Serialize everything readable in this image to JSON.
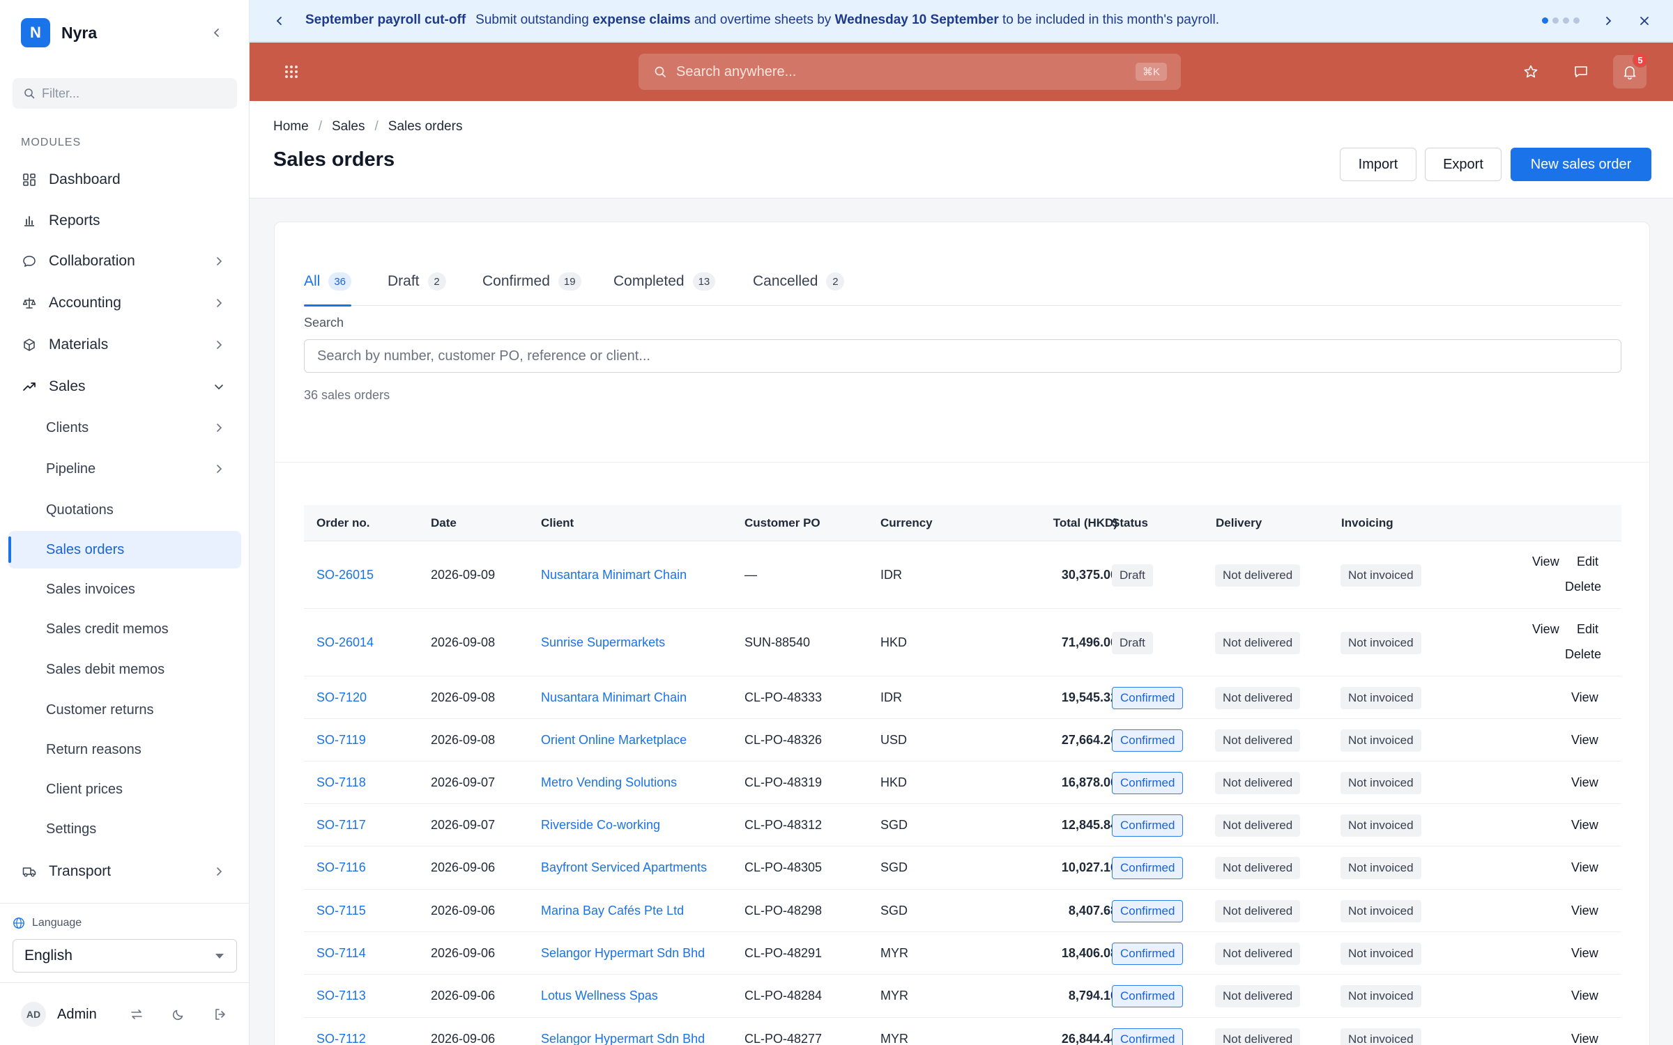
{
  "brand": {
    "logo_letter": "N",
    "name": "Nyra"
  },
  "sidebar": {
    "filter_placeholder": "Filter...",
    "section_label": "MODULES",
    "items": [
      {
        "label": "Dashboard",
        "icon": "dashboard-icon"
      },
      {
        "label": "Reports",
        "icon": "bar-chart-icon"
      },
      {
        "label": "Collaboration",
        "icon": "chat-bubble-icon"
      },
      {
        "label": "Accounting",
        "icon": "scale-icon"
      },
      {
        "label": "Materials",
        "icon": "box-icon"
      },
      {
        "label": "Sales",
        "icon": "trending-up-icon"
      },
      {
        "label": "Transport",
        "icon": "truck-icon"
      }
    ],
    "sales_sub": [
      {
        "label": "Clients"
      },
      {
        "label": "Pipeline"
      },
      {
        "label": "Quotations"
      },
      {
        "label": "Sales orders"
      },
      {
        "label": "Sales invoices"
      },
      {
        "label": "Sales credit memos"
      },
      {
        "label": "Sales debit memos"
      },
      {
        "label": "Customer returns"
      },
      {
        "label": "Return reasons"
      },
      {
        "label": "Client prices"
      },
      {
        "label": "Settings"
      }
    ],
    "language_label": "Language",
    "language_value": "English",
    "user": {
      "initials": "AD",
      "name": "Admin"
    }
  },
  "banner": {
    "title": "September payroll cut-off",
    "text_1": "Submit outstanding ",
    "bold_1": "expense claims",
    "text_2": " and overtime sheets by ",
    "bold_2": "Wednesday 10 September",
    "text_3": " to be included in this month's payroll."
  },
  "topbar": {
    "search_placeholder": "Search anywhere...",
    "shortcut": "⌘K",
    "notification_count": "5",
    "accent": "#c85a47"
  },
  "breadcrumb": {
    "home": "Home",
    "sales": "Sales",
    "current": "Sales orders"
  },
  "page": {
    "title": "Sales orders",
    "import_label": "Import",
    "export_label": "Export",
    "new_label": "New sales order"
  },
  "tabs": [
    {
      "label": "All",
      "count": "36"
    },
    {
      "label": "Draft",
      "count": "2"
    },
    {
      "label": "Confirmed",
      "count": "19"
    },
    {
      "label": "Completed",
      "count": "13"
    },
    {
      "label": "Cancelled",
      "count": "2"
    }
  ],
  "search": {
    "label": "Search",
    "placeholder": "Search by number, customer PO, reference or client..."
  },
  "result_count": "36 sales orders",
  "table": {
    "columns": [
      "Order no.",
      "Date",
      "Client",
      "Customer PO",
      "Currency",
      "Total (HKD)",
      "Status",
      "Delivery",
      "Invoicing"
    ],
    "rows": [
      {
        "no": "SO-26015",
        "date": "2026-09-09",
        "client": "Nusantara Minimart Chain",
        "po": "—",
        "cur": "IDR",
        "total": "30,375.00",
        "status": "Draft",
        "delivery": "Not delivered",
        "invoicing": "Not invoiced",
        "view": "View",
        "edit": "Edit",
        "delete": "Delete"
      },
      {
        "no": "SO-26014",
        "date": "2026-09-08",
        "client": "Sunrise Supermarkets",
        "po": "SUN-88540",
        "cur": "HKD",
        "total": "71,496.00",
        "status": "Draft",
        "delivery": "Not delivered",
        "invoicing": "Not invoiced",
        "view": "View",
        "edit": "Edit",
        "delete": "Delete"
      },
      {
        "no": "SO-7120",
        "date": "2026-09-08",
        "client": "Nusantara Minimart Chain",
        "po": "CL-PO-48333",
        "cur": "IDR",
        "total": "19,545.32",
        "status": "Confirmed",
        "delivery": "Not delivered",
        "invoicing": "Not invoiced",
        "view": "View"
      },
      {
        "no": "SO-7119",
        "date": "2026-09-08",
        "client": "Orient Online Marketplace",
        "po": "CL-PO-48326",
        "cur": "USD",
        "total": "27,664.26",
        "status": "Confirmed",
        "delivery": "Not delivered",
        "invoicing": "Not invoiced",
        "view": "View"
      },
      {
        "no": "SO-7118",
        "date": "2026-09-07",
        "client": "Metro Vending Solutions",
        "po": "CL-PO-48319",
        "cur": "HKD",
        "total": "16,878.00",
        "status": "Confirmed",
        "delivery": "Not delivered",
        "invoicing": "Not invoiced",
        "view": "View"
      },
      {
        "no": "SO-7117",
        "date": "2026-09-07",
        "client": "Riverside Co-working",
        "po": "CL-PO-48312",
        "cur": "SGD",
        "total": "12,845.84",
        "status": "Confirmed",
        "delivery": "Not delivered",
        "invoicing": "Not invoiced",
        "view": "View"
      },
      {
        "no": "SO-7116",
        "date": "2026-09-06",
        "client": "Bayfront Serviced Apartments",
        "po": "CL-PO-48305",
        "cur": "SGD",
        "total": "10,027.16",
        "status": "Confirmed",
        "delivery": "Not delivered",
        "invoicing": "Not invoiced",
        "view": "View"
      },
      {
        "no": "SO-7115",
        "date": "2026-09-06",
        "client": "Marina Bay Cafés Pte Ltd",
        "po": "CL-PO-48298",
        "cur": "SGD",
        "total": "8,407.68",
        "status": "Confirmed",
        "delivery": "Not delivered",
        "invoicing": "Not invoiced",
        "view": "View"
      },
      {
        "no": "SO-7114",
        "date": "2026-09-06",
        "client": "Selangor Hypermart Sdn Bhd",
        "po": "CL-PO-48291",
        "cur": "MYR",
        "total": "18,406.08",
        "status": "Confirmed",
        "delivery": "Not delivered",
        "invoicing": "Not invoiced",
        "view": "View"
      },
      {
        "no": "SO-7113",
        "date": "2026-09-06",
        "client": "Lotus Wellness Spas",
        "po": "CL-PO-48284",
        "cur": "MYR",
        "total": "8,794.10",
        "status": "Confirmed",
        "delivery": "Not delivered",
        "invoicing": "Not invoiced",
        "view": "View"
      },
      {
        "no": "SO-7112",
        "date": "2026-09-06",
        "client": "Selangor Hypermart Sdn Bhd",
        "po": "CL-PO-48277",
        "cur": "MYR",
        "total": "26,844.44",
        "status": "Confirmed",
        "delivery": "Not delivered",
        "invoicing": "Not invoiced",
        "view": "View"
      }
    ]
  }
}
